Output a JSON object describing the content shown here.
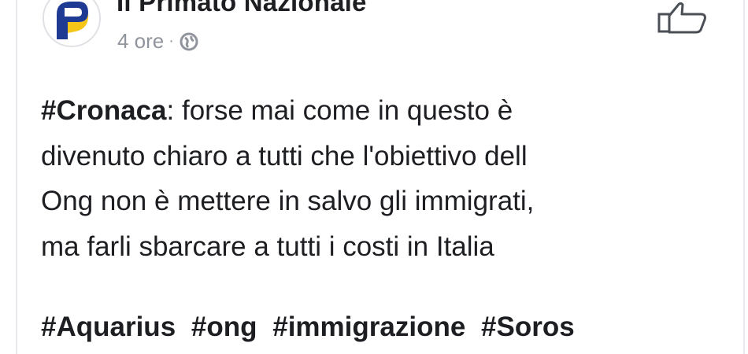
{
  "post": {
    "page_name": "Il Primato Nazionale",
    "time": "4 ore",
    "separator": "·",
    "privacy_icon": "globe-icon",
    "like_icon": "thumbs-up-icon",
    "lead_hashtag": "#Cronaca",
    "lines": [
      ": forse mai come in questo è",
      "divenuto chiaro a tutti che l'obiettivo dell",
      "Ong non è mettere in salvo gli immigrati,",
      "ma farli sbarcare a tutti i costi in Italia"
    ],
    "hashtags": [
      "#Aquarius",
      "#ong",
      "#immigrazione",
      "#Soros"
    ]
  },
  "colors": {
    "text": "#1c1e21",
    "meta": "#90949c",
    "logo_blue": "#1f3a93",
    "logo_yellow": "#f5c518"
  }
}
